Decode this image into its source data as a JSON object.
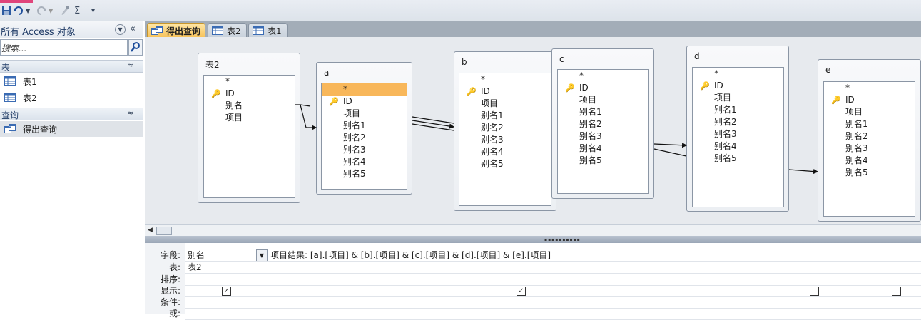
{
  "qat": {
    "undo_icon": "undo-icon",
    "redo_icon": "redo-icon",
    "sum_glyph": "Σ"
  },
  "nav": {
    "title": "所有 Access 对象",
    "search_placeholder": "搜索...",
    "groups": [
      {
        "label": "表",
        "items": [
          "表1",
          "表2"
        ]
      },
      {
        "label": "查询",
        "items": [
          "得出查询"
        ]
      }
    ]
  },
  "tabs": [
    "得出查询",
    "表2",
    "表1"
  ],
  "design": {
    "tables": [
      {
        "title": "表2",
        "fields": [
          "*",
          "ID",
          "别名",
          "项目"
        ]
      },
      {
        "title": "a",
        "fields": [
          "*",
          "ID",
          "项目",
          "别名1",
          "别名2",
          "别名3",
          "别名4",
          "别名5"
        ]
      },
      {
        "title": "b",
        "fields": [
          "*",
          "ID",
          "项目",
          "别名1",
          "别名2",
          "别名3",
          "别名4",
          "别名5"
        ]
      },
      {
        "title": "c",
        "fields": [
          "*",
          "ID",
          "项目",
          "别名1",
          "别名2",
          "别名3",
          "别名4",
          "别名5"
        ]
      },
      {
        "title": "d",
        "fields": [
          "*",
          "ID",
          "项目",
          "别名1",
          "别名2",
          "别名3",
          "别名4",
          "别名5"
        ]
      },
      {
        "title": "e",
        "fields": [
          "*",
          "ID",
          "项目",
          "别名1",
          "别名2",
          "别名3",
          "别名4",
          "别名5"
        ]
      }
    ]
  },
  "grid": {
    "row_labels": [
      "字段:",
      "表:",
      "排序:",
      "显示:",
      "条件:",
      "或:"
    ],
    "columns": [
      {
        "field": "别名",
        "table": "表2",
        "show": true
      },
      {
        "field": "项目结果: [a].[项目] & [b].[项目] & [c].[项目] & [d].[项目] & [e].[项目]",
        "table": "",
        "show": true
      },
      {
        "field": "",
        "table": "",
        "show": false
      },
      {
        "field": "",
        "table": "",
        "show": false
      }
    ]
  },
  "colors": {
    "accent": "#f7c35c",
    "selected_field": "#f8b75a",
    "design_bg": "#e7eaee"
  }
}
